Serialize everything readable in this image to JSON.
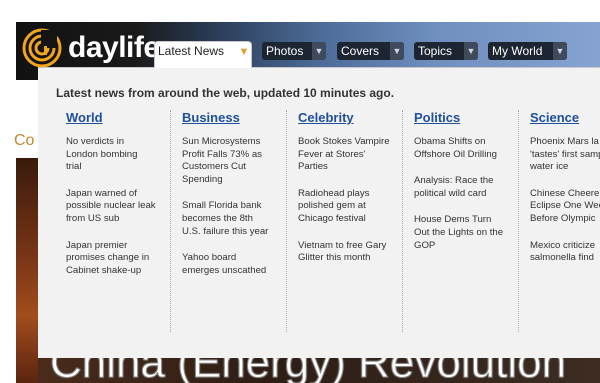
{
  "logo": {
    "text": "daylife"
  },
  "nav": [
    {
      "label": "Latest News",
      "active": true
    },
    {
      "label": "Photos"
    },
    {
      "label": "Covers"
    },
    {
      "label": "Topics"
    },
    {
      "label": "My World"
    }
  ],
  "dropdown": {
    "subtitle": "Latest news from around the web, updated 10 minutes ago.",
    "columns": [
      {
        "title": "World",
        "items": [
          [
            "No verdicts in",
            "London bombing",
            "trial"
          ],
          [
            "Japan warned of",
            "possible nuclear leak",
            "from US sub"
          ],
          [
            "Japan premier",
            "promises change in",
            "Cabinet shake-up"
          ]
        ]
      },
      {
        "title": "Business",
        "items": [
          [
            "Sun Microsystems",
            "Profit Falls 73% as",
            "Customers Cut",
            "Spending"
          ],
          [
            "Small Florida bank",
            "becomes the 8th",
            "U.S. failure this year"
          ],
          [
            "Yahoo board",
            "emerges unscathed"
          ]
        ]
      },
      {
        "title": "Celebrity",
        "items": [
          [
            "Book Stokes Vampire",
            "Fever at Stores'",
            "Parties"
          ],
          [
            "Radiohead plays",
            "polished gem at",
            "Chicago festival"
          ],
          [
            "Vietnam to free Gary",
            "Glitter this month"
          ]
        ]
      },
      {
        "title": "Politics",
        "items": [
          [
            "Obama Shifts on",
            "Offshore Oil Drilling"
          ],
          [
            "Analysis: Race the",
            "political wild card"
          ],
          [
            "House Dems Turn",
            "Out the Lights on the",
            "GOP"
          ]
        ]
      },
      {
        "title": "Science",
        "items": [
          [
            "Phoenix Mars la",
            "'tastes' first samp",
            "water ice"
          ],
          [
            "Chinese Cheere",
            "Eclipse One Wee",
            "Before Olympic"
          ],
          [
            "Mexico criticize",
            "salmonella find"
          ]
        ]
      }
    ]
  },
  "background": {
    "side_label": "Co",
    "headline": "China (Energy) Revolution"
  },
  "colors": {
    "link": "#1f4f9f",
    "panel": "#f2f2f2",
    "accent": "#e0a030"
  }
}
